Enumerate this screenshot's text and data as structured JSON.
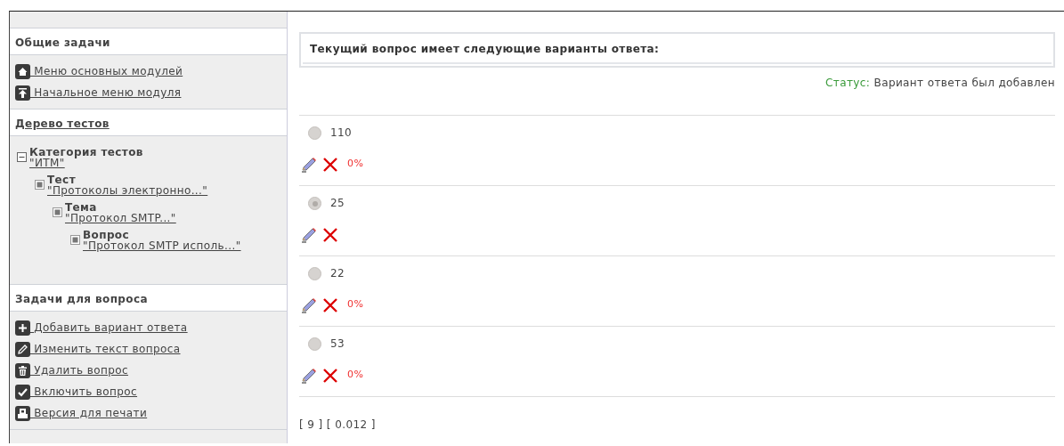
{
  "sidebar": {
    "sections": [
      {
        "title": "Общие задачи",
        "title_link": false,
        "links": [
          "Меню основных модулей",
          "Начальное меню модуля"
        ]
      },
      {
        "title": "Дерево тестов",
        "title_link": true,
        "tree": [
          {
            "kind": "Категория тестов",
            "label": "\"ИТМ\"",
            "expanded": true,
            "children": [
              {
                "kind": "Тест",
                "label": "\"Протоколы электронно...\"",
                "expanded": false,
                "children": [
                  {
                    "kind": "Тема",
                    "label": "\"Протокол SMTP...\"",
                    "expanded": false,
                    "children": [
                      {
                        "kind": "Вопрос",
                        "label": "\"Протокол SMTP исполь...\"",
                        "expanded": false
                      }
                    ]
                  }
                ]
              }
            ]
          }
        ]
      },
      {
        "title": "Задачи для вопроса",
        "title_link": false,
        "links": [
          "Добавить вариант ответа",
          "Изменить текст вопроса",
          "Удалить вопрос",
          "Включить вопрос",
          "Версия для печати"
        ]
      }
    ]
  },
  "main": {
    "heading": "Текущий вопрос имеет следующие варианты ответа:",
    "status": {
      "label": "Статус:",
      "message": "Вариант ответа был добавлен"
    },
    "answers": [
      {
        "value": "110",
        "selected": false,
        "percent": "0%"
      },
      {
        "value": "25",
        "selected": true
      },
      {
        "value": "22",
        "selected": false,
        "percent": "0%"
      },
      {
        "value": "53",
        "selected": false,
        "percent": "0%"
      }
    ],
    "footer": "[ 9 ] [ 0.012 ]"
  }
}
